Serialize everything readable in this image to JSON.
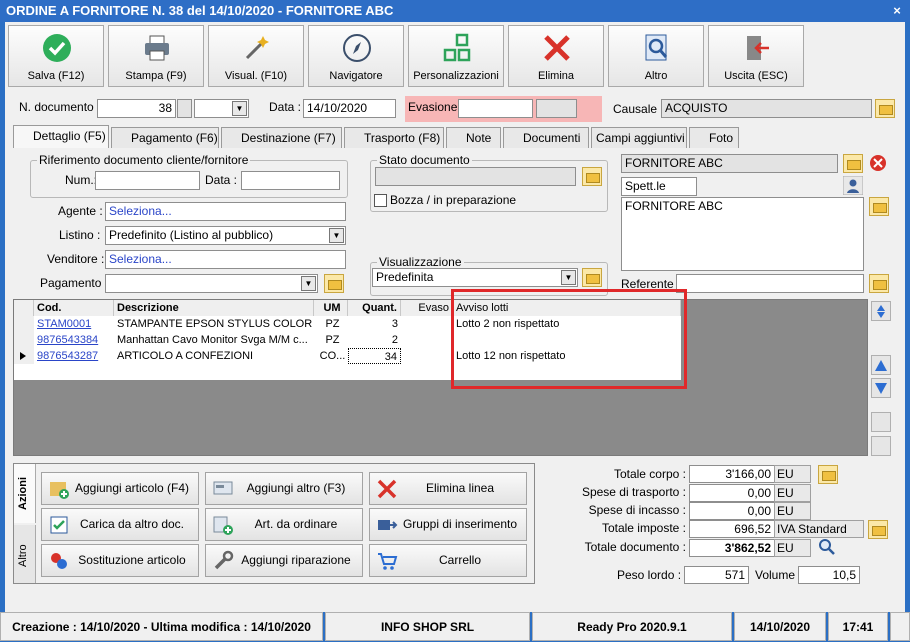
{
  "window": {
    "title": "ORDINE A FORNITORE N. 38 del 14/10/2020 - FORNITORE ABC",
    "close": "×"
  },
  "toolbar": {
    "save": "Salva (F12)",
    "print": "Stampa (F9)",
    "visual": "Visual. (F10)",
    "navigator": "Navigatore",
    "custom": "Personalizzazioni",
    "delete": "Elimina",
    "other": "Altro",
    "exit": "Uscita (ESC)"
  },
  "header": {
    "doc_num_label": "N. documento :",
    "doc_num": "38",
    "date_label": "Data :",
    "date": "14/10/2020",
    "evasion_label": "Evasione:",
    "cause_label": "Causale :",
    "cause": "ACQUISTO"
  },
  "tabs": [
    "Dettaglio (F5)",
    "Pagamento (F6)",
    "Destinazione (F7)",
    "Trasporto (F8)",
    "Note",
    "Documenti",
    "Campi aggiuntivi",
    "Foto"
  ],
  "ref": {
    "group_label": "Riferimento documento cliente/fornitore",
    "num_label": "Num.:",
    "date_label": "Data :"
  },
  "agent": {
    "label": "Agente :",
    "value": "Seleziona..."
  },
  "list": {
    "label": "Listino :",
    "value": "Predefinito (Listino al pubblico)"
  },
  "seller": {
    "label": "Venditore :",
    "value": "Seleziona..."
  },
  "payment": {
    "label": "Pagamento :"
  },
  "state": {
    "group_label": "Stato documento",
    "draft": "Bozza / in preparazione"
  },
  "view": {
    "group_label": "Visualizzazione",
    "value": "Predefinita"
  },
  "supplier": {
    "name": "FORNITORE ABC",
    "salutation": "Spett.le",
    "address": "FORNITORE ABC",
    "referent_label": "Referente"
  },
  "grid": {
    "headers": [
      "Cod.",
      "Descrizione",
      "UM",
      "Quant.",
      "Evaso",
      "Avviso lotti"
    ],
    "rows": [
      {
        "code": "STAM0001",
        "desc": "STAMPANTE EPSON STYLUS COLOR C...",
        "um": "PZ",
        "qty": "3",
        "warn": "Lotto 2 non rispettato"
      },
      {
        "code": "9876543384",
        "desc": "Manhattan Cavo Monitor Svga M/M c...",
        "um": "PZ",
        "qty": "2",
        "warn": ""
      },
      {
        "code": "9876543287",
        "desc": "ARTICOLO A CONFEZIONI",
        "um": "CO...",
        "qty": "34",
        "warn": "Lotto 12 non rispettato"
      }
    ]
  },
  "side_tabs": {
    "actions": "Azioni",
    "other": "Altro"
  },
  "actions": [
    "Aggiungi articolo (F4)",
    "Aggiungi altro (F3)",
    "Elimina linea",
    "Carica da altro doc.",
    "Art. da ordinare",
    "Gruppi di inserimento",
    "Sostituzione articolo",
    "Aggiungi riparazione",
    "Carrello"
  ],
  "totals": {
    "body_label": "Totale corpo :",
    "body": "3'166,00",
    "body_unit": "EU",
    "transport_label": "Spese di trasporto :",
    "transport": "0,00",
    "transport_unit": "EU",
    "collection_label": "Spese di incasso :",
    "collection": "0,00",
    "collection_unit": "EU",
    "tax_label": "Totale imposte :",
    "tax": "696,52",
    "tax_unit": "IVA Standard",
    "doc_label": "Totale documento :",
    "doc": "3'862,52",
    "doc_unit": "EU",
    "weight_label": "Peso lordo :",
    "weight": "571",
    "volume_label": "Volume :",
    "volume": "10,5"
  },
  "status": {
    "created": "Creazione : 14/10/2020 - Ultima modifica : 14/10/2020",
    "company": "INFO SHOP SRL",
    "version": "Ready Pro 2020.9.1",
    "date": "14/10/2020",
    "time": "17:41"
  },
  "colors": {
    "highlight": "#e0282a",
    "titlebar": "#2e6ec6",
    "evasion_bg": "#f7b6b6"
  }
}
